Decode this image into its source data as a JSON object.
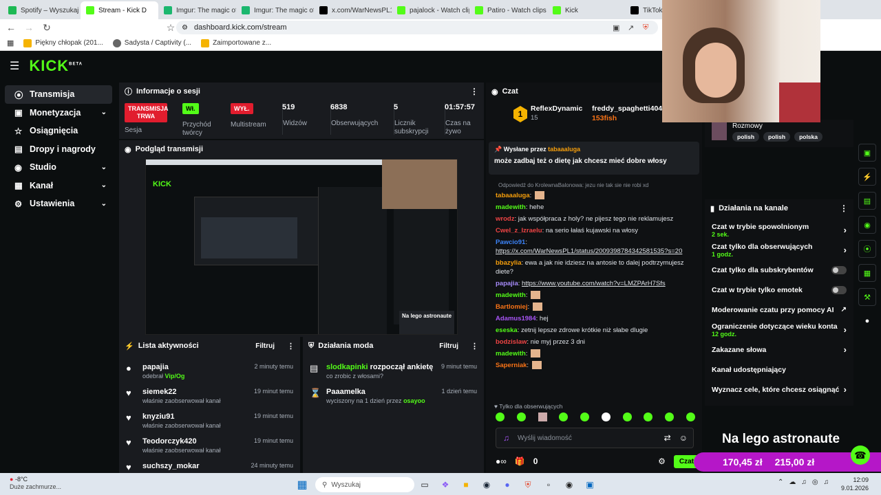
{
  "browser": {
    "tabs": [
      {
        "label": "Spotify – Wyszukaj",
        "color": "#1db954"
      },
      {
        "label": "Stream - Kick D",
        "color": "#53fc18"
      },
      {
        "label": "Imgur: The magic of th",
        "color": "#1bb76e"
      },
      {
        "label": "Imgur: The magic of th",
        "color": "#1bb76e"
      },
      {
        "label": "x.com/WarNewsPL1/st",
        "color": "#000000"
      },
      {
        "label": "pajalock - Watch clips",
        "color": "#53fc18"
      },
      {
        "label": "Patiro - Watch clips on",
        "color": "#53fc18"
      },
      {
        "label": "Kick",
        "color": "#53fc18"
      },
      {
        "label": "TikTok",
        "color": "#000000"
      }
    ],
    "url": "dashboard.kick.com/stream",
    "bookmarks": [
      "Piękny chłopak (201...",
      "Sadysta / Captivity (...",
      "Zaimportowane z..."
    ]
  },
  "sidebar": {
    "items": [
      {
        "label": "Transmisja",
        "icon": "broadcast-icon"
      },
      {
        "label": "Monetyzacja",
        "icon": "money-icon"
      },
      {
        "label": "Osiągnięcia",
        "icon": "trophy-icon"
      },
      {
        "label": "Dropy i nagrody",
        "icon": "gift-icon"
      },
      {
        "label": "Studio",
        "icon": "studio-icon"
      },
      {
        "label": "Kanał",
        "icon": "channel-icon"
      },
      {
        "label": "Ustawienia",
        "icon": "gear-icon"
      }
    ]
  },
  "session": {
    "title": "Informacje o sesji",
    "live_badge": "TRANSMISJA TRWA",
    "live_label": "Sesja",
    "przychod_badge": "Wł.",
    "przychod_label": "Przychód twórcy",
    "multistream_badge": "WYŁ.",
    "multistream_label": "Multistream",
    "stats": [
      {
        "value": "519",
        "label": "Widzów"
      },
      {
        "value": "6838",
        "label": "Obserwujących"
      },
      {
        "value": "5",
        "label": "Licznik subskrypcji"
      },
      {
        "value": "01:57:57",
        "label": "Czas na żywo"
      }
    ]
  },
  "preview": {
    "title": "Podgląd transmisji"
  },
  "activity": {
    "title": "Lista aktywności",
    "filter": "Filtruj",
    "items": [
      {
        "name": "papajia",
        "sub": "odebrał ",
        "subhl": "Vip/Og",
        "time": "2 minuty temu",
        "icon": "chip-icon"
      },
      {
        "name": "siemek22",
        "sub": "właśnie zaobserwował kanał",
        "subhl": "",
        "time": "19 minut temu",
        "icon": "heart-icon"
      },
      {
        "name": "knyziu91",
        "sub": "właśnie zaobserwował kanał",
        "subhl": "",
        "time": "19 minut temu",
        "icon": "heart-icon"
      },
      {
        "name": "Teodorczyk420",
        "sub": "właśnie zaobserwował kanał",
        "subhl": "",
        "time": "19 minut temu",
        "icon": "heart-icon"
      },
      {
        "name": "suchszy_mokar",
        "sub": "",
        "subhl": "",
        "time": "24 minuty temu",
        "icon": "heart-icon"
      }
    ]
  },
  "modactions": {
    "title": "Działania moda",
    "filter": "Filtruj",
    "items": [
      {
        "name": "slodkapinki",
        "action": " rozpoczął ankietę",
        "sub": "co zrobic z włosami?",
        "time": "9 minut temu",
        "icon": "poll-icon"
      },
      {
        "name": "Paaamelka",
        "action": "",
        "sub": "wyciszony na 1 dzień przez ",
        "subhl": "osayoo",
        "time": "1 dzień temu",
        "icon": "hourglass-icon"
      }
    ]
  },
  "chat": {
    "title": "Czat",
    "top": [
      {
        "rank": "1",
        "name": "ReflexDynamic",
        "count": "15"
      },
      {
        "name": "freddy_spaghetti404",
        "gift": "153fish"
      }
    ],
    "pinned_by_label": "Wysłane przez",
    "pinned_by_user": "tabaaaluga",
    "pinned_text": "może zadbaj też o dietę jak chcesz mieć dobre włosy",
    "reply_note": "Odpowiedź do KrolewnaBalonowa: jezu nie tak sie nie robi xd",
    "messages": [
      {
        "user": "tabaaaluga",
        "color": "#f59e0b",
        "text": ""
      },
      {
        "user": "madewith",
        "color": "#53fc18",
        "text": "hehe"
      },
      {
        "user": "wrodz",
        "color": "#ef4444",
        "text": "jak współpraca z holy? ne pijesz tego nie reklamujesz"
      },
      {
        "user": "Cwel_z_Izraelu",
        "color": "#ef4444",
        "text": "na serio łałaś kujawski na włosy"
      },
      {
        "user": "Pawcio91",
        "color": "#3b82f6",
        "text": "https://x.com/WarNewsPL1/status/2009398784342581535?s=20"
      },
      {
        "user": "bbazylia",
        "color": "#f59e0b",
        "text": "ewa a jak nie idziesz na antosie to dalej podtrzymujesz diete?"
      },
      {
        "user": "papajia",
        "color": "#a78bfa",
        "text": "https://www.youtube.com/watch?v=LMZPArH7Sfs"
      },
      {
        "user": "madewith",
        "color": "#53fc18",
        "text": ""
      },
      {
        "user": "Bartlomiej",
        "color": "#f97316",
        "text": ""
      },
      {
        "user": "Adamus1984",
        "color": "#a855f7",
        "text": "hej"
      },
      {
        "user": "eseska",
        "color": "#53fc18",
        "text": "zetnij lepsze zdrowe krótkie niż słabe dlugie"
      },
      {
        "user": "bodzislaw",
        "color": "#ef4444",
        "text": "nie myj przez 3 dni"
      },
      {
        "user": "madewith",
        "color": "#53fc18",
        "text": ""
      },
      {
        "user": "Saperniak",
        "color": "#f97316",
        "text": ""
      }
    ],
    "followers_only": "Tylko dla obserwujących",
    "input_placeholder": "Wyślij wiadomość",
    "send_label": "Czat",
    "points": "0"
  },
  "channel_actions": {
    "title": "Działania na kanale",
    "tags": [
      "polish",
      "polish",
      "polska"
    ],
    "tags_label": "Rozmowy",
    "items": [
      {
        "label": "Czat w trybie spowolnionym",
        "sub": "2 sek.",
        "kind": "chevron"
      },
      {
        "label": "Czat tylko dla obserwujących",
        "sub": "1 godz.",
        "kind": "chevron"
      },
      {
        "label": "Czat tylko dla subskrybentów",
        "sub": "",
        "kind": "toggle"
      },
      {
        "label": "Czat w trybie tylko emotek",
        "sub": "",
        "kind": "toggle"
      },
      {
        "label": "Moderowanie czatu przy pomocy AI",
        "sub": "",
        "kind": "external"
      },
      {
        "label": "Ograniczenie dotyczące wieku konta",
        "sub": "12 godz.",
        "kind": "chevron"
      },
      {
        "label": "Zakazane słowa",
        "sub": "",
        "kind": "chevron"
      },
      {
        "label": "Kanał udostępniający",
        "sub": "",
        "kind": "none"
      },
      {
        "label": "Wyznacz cele, które chcesz osiągnąć",
        "sub": "",
        "kind": "chevron"
      }
    ]
  },
  "overlay": {
    "title": "Na lego astronaute",
    "amount1": "170,45 zł",
    "amount2": "215,00 zł",
    "accent": "#b517c8"
  },
  "taskbar": {
    "weather_temp": "-8°C",
    "weather_desc": "Duże zachmurze...",
    "search_placeholder": "Wyszukaj",
    "time": "12:09",
    "date": "9.01.2026"
  }
}
